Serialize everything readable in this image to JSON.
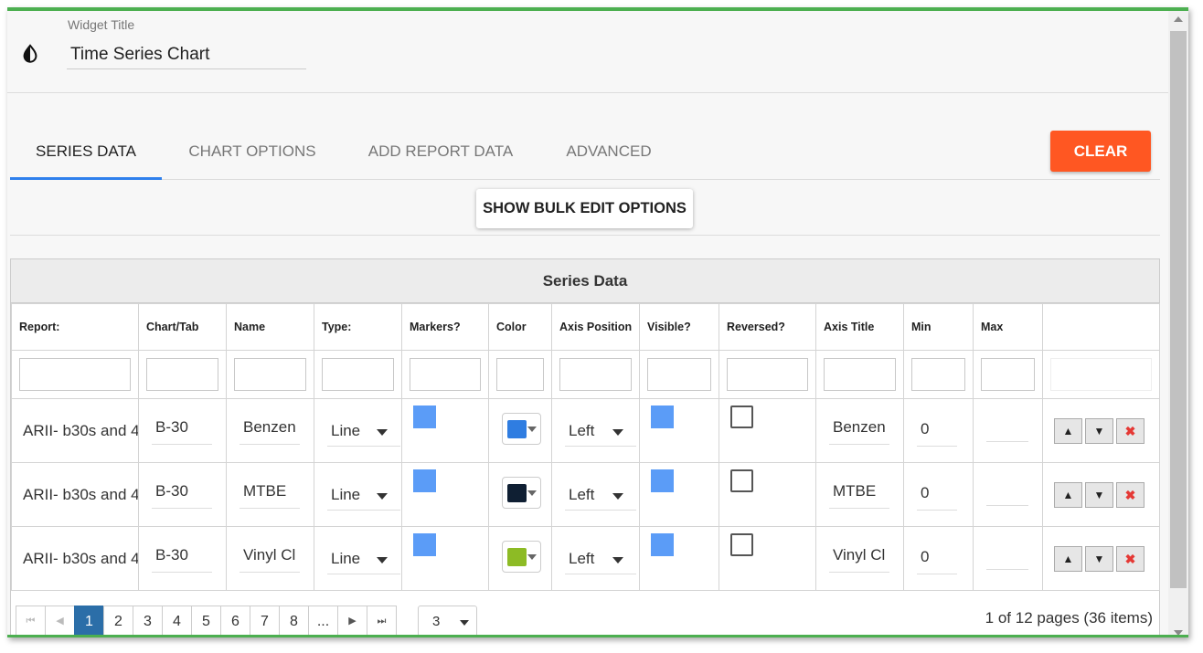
{
  "header": {
    "widget_title_label": "Widget Title",
    "widget_title_value": "Time Series Chart"
  },
  "tabs": [
    {
      "label": "SERIES DATA",
      "active": true
    },
    {
      "label": "CHART OPTIONS",
      "active": false
    },
    {
      "label": "ADD REPORT DATA",
      "active": false
    },
    {
      "label": "ADVANCED",
      "active": false
    }
  ],
  "buttons": {
    "clear": "CLEAR",
    "bulk_edit": "SHOW BULK EDIT OPTIONS"
  },
  "grid": {
    "title": "Series Data",
    "columns": [
      "Report:",
      "Chart/Tab",
      "Name",
      "Type:",
      "Markers?",
      "Color",
      "Axis Position",
      "Visible?",
      "Reversed?",
      "Axis Title",
      "Min",
      "Max"
    ],
    "rows": [
      {
        "report": "ARII- b30s and 4",
        "chart_tab": "B-30",
        "name": "Benzen",
        "type": "Line",
        "markers": true,
        "color": "#2f7de1",
        "axis_position": "Left",
        "visible": true,
        "reversed": false,
        "axis_title": "Benzen",
        "min": "0",
        "max": ""
      },
      {
        "report": "ARII- b30s and 4",
        "chart_tab": "B-30",
        "name": "MTBE",
        "type": "Line",
        "markers": true,
        "color": "#0f1f33",
        "axis_position": "Left",
        "visible": true,
        "reversed": false,
        "axis_title": "MTBE",
        "min": "0",
        "max": ""
      },
      {
        "report": "ARII- b30s and 4",
        "chart_tab": "B-30",
        "name": "Vinyl Cl",
        "type": "Line",
        "markers": true,
        "color": "#8dbb25",
        "axis_position": "Left",
        "visible": true,
        "reversed": false,
        "axis_title": "Vinyl Cl",
        "min": "0",
        "max": ""
      }
    ]
  },
  "pager": {
    "pages": [
      "1",
      "2",
      "3",
      "4",
      "5",
      "6",
      "7",
      "8",
      "..."
    ],
    "current_page": "1",
    "page_size": "3",
    "info": "1 of 12 pages (36 items)"
  },
  "colors": {
    "accent_green": "#4caf50",
    "clear_button": "#ff5722",
    "tab_underline": "#2f80ed",
    "pager_active": "#2b6ea8",
    "checkbox_checked": "#5b9cf7"
  }
}
